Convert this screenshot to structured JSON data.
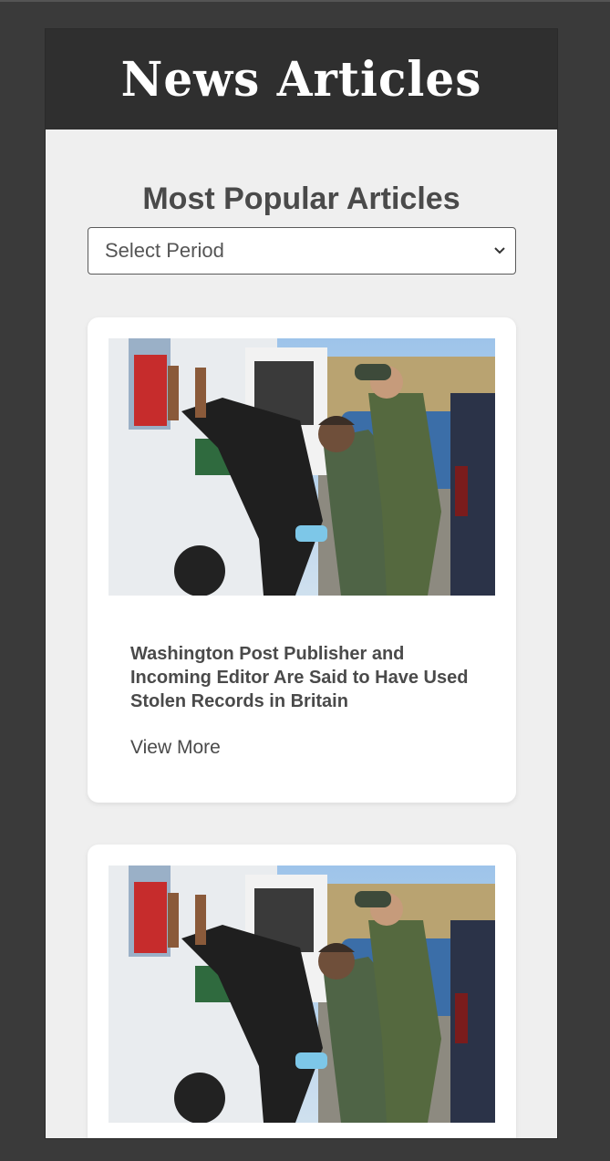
{
  "header": {
    "title": "News Articles"
  },
  "main": {
    "heading": "Most Popular Articles",
    "period_select": {
      "selected": "Select Period",
      "icon": "chevron-down-icon"
    },
    "articles": [
      {
        "headline": "Washington Post Publisher and Incoming Editor Are Said to Have Used Stolen Records in Britain",
        "link_label": "View More",
        "image": "photo-border-patrol-agents-searching-person-against-van"
      },
      {
        "headline": "",
        "link_label": "",
        "image": "photo-border-patrol-agents-searching-person-against-van"
      }
    ]
  },
  "colors": {
    "page_background": "#3a3a3a",
    "header_background": "#2f2f2f",
    "content_background": "#efefef",
    "text": "#4a4a4a"
  }
}
